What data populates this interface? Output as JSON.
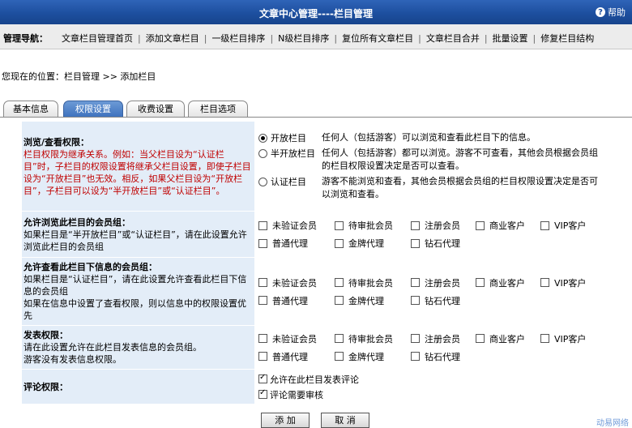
{
  "header": {
    "title": "文章中心管理----栏目管理",
    "help_label": "帮助",
    "help_glyph": "?"
  },
  "nav": {
    "label": "管理导航：",
    "links": [
      "文章栏目管理首页",
      "添加文章栏目",
      "一级栏目排序",
      "N级栏目排序",
      "复位所有文章栏目",
      "文章栏目合并",
      "批量设置",
      "修复栏目结构"
    ],
    "separator": "|"
  },
  "location": "您现在的位置：栏目管理 >> 添加栏目",
  "tabs": [
    {
      "label": "基本信息",
      "active": false
    },
    {
      "label": "权限设置",
      "active": true
    },
    {
      "label": "收费设置",
      "active": false
    },
    {
      "label": "栏目选项",
      "active": false
    }
  ],
  "permission": {
    "title": "浏览/查看权限：",
    "note": "栏目权限为继承关系。例如：当父栏目设为“认证栏目”时，子栏目的权限设置将继承父栏目设置，即使子栏目设为“开放栏目”也无效。相反，如果父栏目设为“开放栏目”，子栏目可以设为“半开放栏目”或“认证栏目”。",
    "options": [
      {
        "label": "开放栏目",
        "desc": "任何人（包括游客）可以浏览和查看此栏目下的信息。",
        "selected": true
      },
      {
        "label": "半开放栏目",
        "desc": "任何人（包括游客）都可以浏览。游客不可查看，其他会员根据会员组的栏目权限设置决定是否可以查看。",
        "selected": false
      },
      {
        "label": "认证栏目",
        "desc": "游客不能浏览和查看，其他会员根据会员组的栏目权限设置决定是否可以浏览和查看。",
        "selected": false
      }
    ]
  },
  "groups": [
    "未验证会员",
    "待审批会员",
    "注册会员",
    "商业客户",
    "VIP客户",
    "普通代理",
    "金牌代理",
    "钻石代理"
  ],
  "sections": [
    {
      "title": "允许浏览此栏目的会员组：",
      "desc": "如果栏目是“半开放栏目”或“认证栏目”，请在此设置允许浏览此栏目的会员组"
    },
    {
      "title": "允许查看此栏目下信息的会员组：",
      "desc": "如果栏目是“认证栏目”，请在此设置允许查看此栏目下信息的会员组",
      "desc2": "如果在信息中设置了查看权限，则以信息中的权限设置优先"
    },
    {
      "title": "发表权限：",
      "desc": "请在此设置允许在此栏目发表信息的会员组。",
      "desc2": "游客没有发表信息权限。"
    }
  ],
  "comment": {
    "title": "评论权限：",
    "options": [
      {
        "label": "允许在此栏目发表评论",
        "checked": true
      },
      {
        "label": "评论需要审核",
        "checked": true
      }
    ]
  },
  "buttons": {
    "add": "添 加",
    "cancel": "取 消"
  },
  "watermark": "动易网络",
  "colors": {
    "header_blue": "#1d4f9f",
    "label_bg": "#e3edf8",
    "note_red": "#c00000",
    "active_tab": "#3f73be"
  }
}
